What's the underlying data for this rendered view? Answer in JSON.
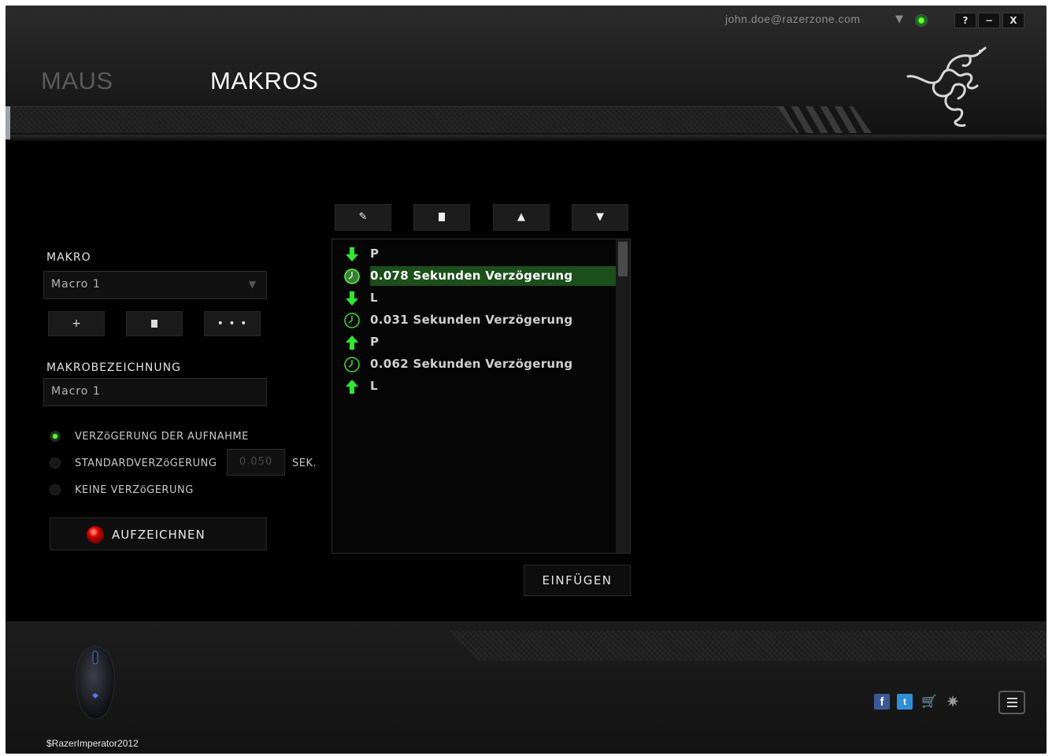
{
  "account": {
    "email": "john.doe@razerzone.com"
  },
  "window_controls": {
    "help": "?",
    "minimize": "−",
    "close": "X"
  },
  "tabs": [
    {
      "label": "MAUS",
      "active": false
    },
    {
      "label": "MAKROS",
      "active": true
    }
  ],
  "macro_section": {
    "label": "MAKRO",
    "selected": "Macro 1",
    "buttons": {
      "add": "+",
      "delete": "🗑",
      "more": "• • •"
    }
  },
  "name_section": {
    "label": "MAKROBEZEICHNUNG",
    "value": "Macro 1"
  },
  "delay_options": [
    {
      "label": "VERZöGERUNG DER AUFNAHME",
      "selected": true
    },
    {
      "label": "STANDARDVERZöGERUNG",
      "selected": false
    },
    {
      "label": "KEINE VERZöGERUNG",
      "selected": false
    }
  ],
  "default_delay": {
    "value": "0.050",
    "unit": "SEK."
  },
  "record_button": {
    "label": "AUFZEICHNEN"
  },
  "editor_toolbar": {
    "edit": "✎",
    "delete": "🗑",
    "up": "▲",
    "down": "▼"
  },
  "macro_steps": [
    {
      "type": "key-down",
      "text": "P",
      "selected": false
    },
    {
      "type": "delay",
      "text": "0.078 Sekunden Verzögerung",
      "selected": true
    },
    {
      "type": "key-down",
      "text": "L",
      "selected": false
    },
    {
      "type": "delay",
      "text": "0.031 Sekunden Verzögerung",
      "selected": false
    },
    {
      "type": "key-up",
      "text": "P",
      "selected": false
    },
    {
      "type": "delay",
      "text": "0.062 Sekunden Verzögerung",
      "selected": false
    },
    {
      "type": "key-up",
      "text": "L",
      "selected": false
    }
  ],
  "insert_button": {
    "label": "EINFÜGEN"
  },
  "device": {
    "name": "$RazerImperator2012"
  },
  "footer_icons": [
    "facebook-icon",
    "twitter-icon",
    "cart-icon",
    "razer-icon",
    "menu-icon"
  ],
  "colors": {
    "accent_green": "#44ff22",
    "selection": "#1b4f1b",
    "record_red": "#e00000"
  }
}
